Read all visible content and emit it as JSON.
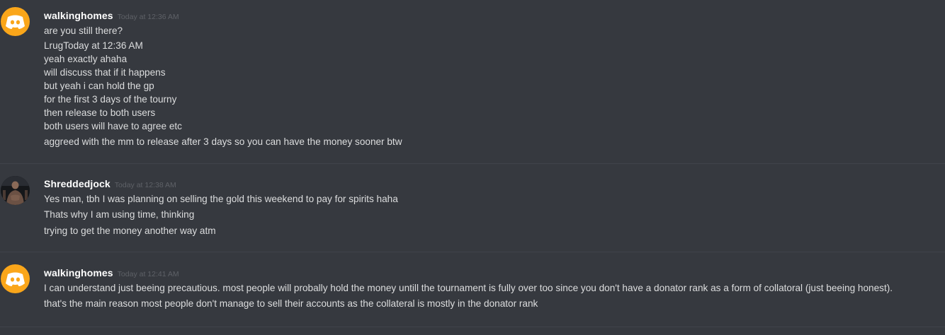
{
  "messages": [
    {
      "username": "walkinghomes",
      "timestamp": "Today at 12:36 AM",
      "avatar_icon": "discord-logo-icon",
      "avatar_color": "#faa61a",
      "lines": [
        "are you still there?",
        "LrugToday at 12:36 AM",
        "yeah exactly ahaha",
        "will discuss that if it happens",
        "but yeah i can hold the gp",
        "for the first 3 days of the tourny",
        "then release to both users",
        "both users will have to agree etc",
        "aggreed with the mm to release after 3 days so you can have the money sooner btw"
      ]
    },
    {
      "username": "Shreddedjock",
      "timestamp": "Today at 12:38 AM",
      "avatar_icon": "user-photo-avatar",
      "lines": [
        "Yes man, tbh I was planning on selling the gold this weekend to pay for spirits haha",
        "Thats why I am using time, thinking",
        "trying to get the money another way atm"
      ]
    },
    {
      "username": "walkinghomes",
      "timestamp": "Today at 12:41 AM",
      "avatar_icon": "discord-logo-icon",
      "avatar_color": "#faa61a",
      "lines": [
        "I can understand just beeing precautious. most people will probally hold the money untill the tournament is fully over too since you don't have a donator rank as a form of collatoral (just beeing honest).",
        "that's the main reason most people don't manage to sell their accounts as the collateral is mostly in the donator rank"
      ]
    }
  ],
  "colors": {
    "background": "#36393f",
    "username": "#ffffff",
    "text": "#dcddde",
    "timestamp": "#5e6167",
    "divider": "#40434a"
  }
}
